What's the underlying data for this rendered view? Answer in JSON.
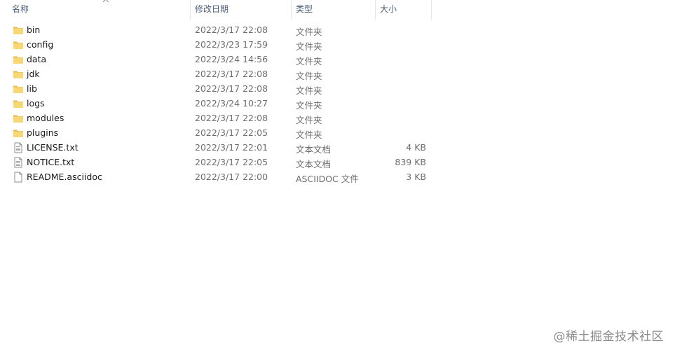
{
  "columns": {
    "name": "名称",
    "date": "修改日期",
    "type": "类型",
    "size": "大小"
  },
  "files": [
    {
      "name": "bin",
      "date": "2022/3/17 22:08",
      "type": "文件夹",
      "size": "",
      "icon": "folder-icon"
    },
    {
      "name": "config",
      "date": "2022/3/23 17:59",
      "type": "文件夹",
      "size": "",
      "icon": "folder-icon"
    },
    {
      "name": "data",
      "date": "2022/3/24 14:56",
      "type": "文件夹",
      "size": "",
      "icon": "folder-icon"
    },
    {
      "name": "jdk",
      "date": "2022/3/17 22:08",
      "type": "文件夹",
      "size": "",
      "icon": "folder-icon"
    },
    {
      "name": "lib",
      "date": "2022/3/17 22:08",
      "type": "文件夹",
      "size": "",
      "icon": "folder-icon"
    },
    {
      "name": "logs",
      "date": "2022/3/24 10:27",
      "type": "文件夹",
      "size": "",
      "icon": "folder-icon"
    },
    {
      "name": "modules",
      "date": "2022/3/17 22:08",
      "type": "文件夹",
      "size": "",
      "icon": "folder-icon"
    },
    {
      "name": "plugins",
      "date": "2022/3/17 22:05",
      "type": "文件夹",
      "size": "",
      "icon": "folder-icon"
    },
    {
      "name": "LICENSE.txt",
      "date": "2022/3/17 22:01",
      "type": "文本文档",
      "size": "4 KB",
      "icon": "text-file-icon"
    },
    {
      "name": "NOTICE.txt",
      "date": "2022/3/17 22:05",
      "type": "文本文档",
      "size": "839 KB",
      "icon": "text-file-icon"
    },
    {
      "name": "README.asciidoc",
      "date": "2022/3/17 22:00",
      "type": "ASCIIDOC 文件",
      "size": "3 KB",
      "icon": "blank-file-icon"
    }
  ],
  "watermark": "@稀土掘金技术社区",
  "colors": {
    "folder": "#f8d775",
    "folder_dark": "#e8b84a",
    "header_text": "#4c607a",
    "meta_text": "#6d6d6d"
  }
}
